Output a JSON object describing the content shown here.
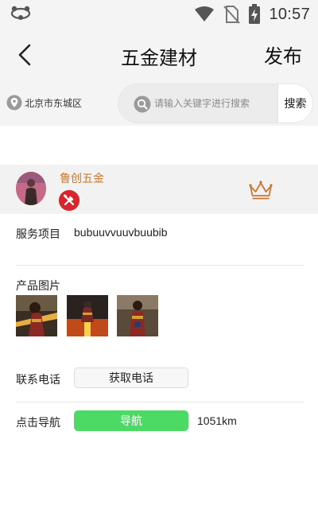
{
  "status_bar": {
    "time": "10:57",
    "icons": [
      "notification-icon",
      "wifi-icon",
      "no-sim-icon",
      "battery-charging-icon"
    ]
  },
  "header": {
    "back_icon": "chevron-left-icon",
    "title": "五金建材",
    "publish_label": "发布"
  },
  "location": {
    "icon": "location-pin-icon",
    "text": "北京市东城区"
  },
  "search": {
    "icon": "search-icon",
    "placeholder": "请输入关键字进行搜索",
    "button_label": "搜索"
  },
  "merchant": {
    "name": "鲁创五金",
    "category_icon": "tools-icon",
    "badge_icon": "crown-icon",
    "colors": {
      "name": "#c9772f",
      "crown": "#c9772f",
      "tools_badge": "#d8252b"
    }
  },
  "details": {
    "service_label": "服务项目",
    "service_value": "bubuuvvuuvbuubib",
    "photos_label": "产品图片",
    "photos": [
      "product-photo-1",
      "product-photo-2",
      "product-photo-3"
    ],
    "phone_label": "联系电话",
    "get_phone_label": "获取电话",
    "nav_label": "点击导航",
    "nav_button_label": "导航",
    "distance": "1051km",
    "colors": {
      "nav_button": "#4cd964"
    }
  }
}
